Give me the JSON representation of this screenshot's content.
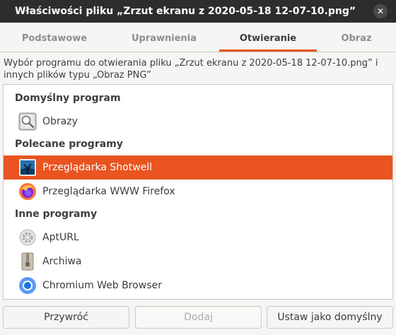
{
  "window": {
    "title": "Właściwości pliku „Zrzut ekranu z 2020-05-18 12-07-10.png”",
    "close_glyph": "✕"
  },
  "tabs": [
    {
      "label": "Podstawowe",
      "active": false
    },
    {
      "label": "Uprawnienia",
      "active": false
    },
    {
      "label": "Otwieranie",
      "active": true
    },
    {
      "label": "Obraz",
      "active": false
    }
  ],
  "description": "Wybór programu do otwierania pliku „Zrzut ekranu z 2020-05-18 12-07-10.png” i innych plików typu „Obraz PNG”",
  "sections": {
    "default": "Domyślny program",
    "recommended": "Polecane programy",
    "other": "Inne programy"
  },
  "apps": {
    "default": [
      {
        "label": "Obrazy",
        "icon": "image-viewer-icon"
      }
    ],
    "recommended": [
      {
        "label": "Przeglądarka Shotwell",
        "icon": "shotwell-icon",
        "selected": true
      },
      {
        "label": "Przeglądarka WWW Firefox",
        "icon": "firefox-icon"
      }
    ],
    "other": [
      {
        "label": "AptURL",
        "icon": "apturl-gear-icon"
      },
      {
        "label": "Archiwa",
        "icon": "archive-zipper-icon"
      },
      {
        "label": "Chromium Web Browser",
        "icon": "chromium-icon"
      }
    ]
  },
  "buttons": {
    "reset": "Przywróć",
    "add": "Dodaj",
    "set_default": "Ustaw jako domyślny"
  },
  "colors": {
    "accent": "#e95420",
    "titlebar": "#2d2d2d"
  }
}
